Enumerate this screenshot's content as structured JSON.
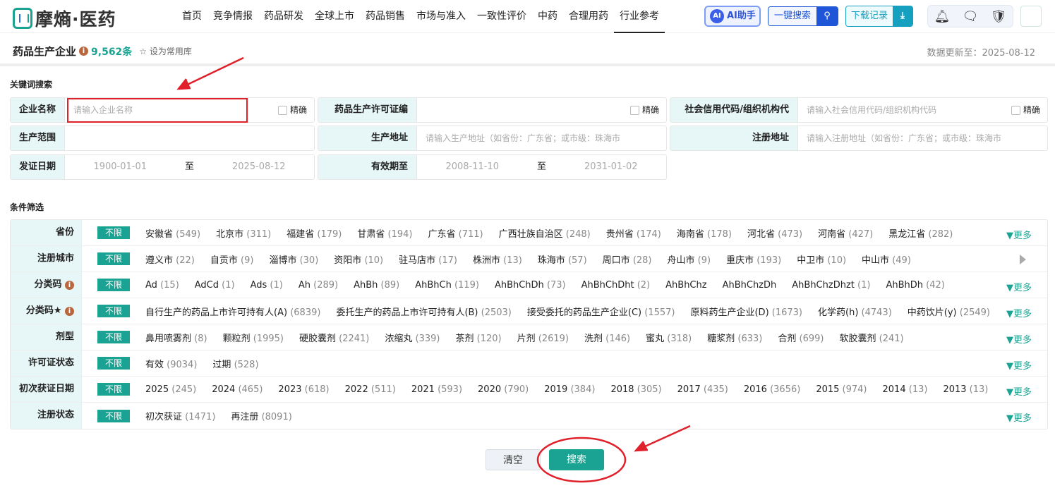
{
  "brand": "摩熵·医药",
  "nav": [
    "首页",
    "竞争情报",
    "药品研发",
    "全球上市",
    "药品销售",
    "市场与准入",
    "一致性评价",
    "中药",
    "合理用药",
    "行业参考"
  ],
  "header_buttons": {
    "ai": "AI助手",
    "one_search": "一键搜索",
    "downloads": "下载记录"
  },
  "page": {
    "title": "药品生产企业",
    "count": "9,562条",
    "favorite": "设为常用库",
    "updated": "数据更新至：2025-08-12"
  },
  "keyword_section": "关键词搜索",
  "fields": {
    "company": {
      "label": "企业名称",
      "placeholder": "请输入企业名称",
      "exact": "精确"
    },
    "license": {
      "label": "药品生产许可证编号",
      "exact": "精确"
    },
    "credit": {
      "label": "社会信用代码/组织机构代码",
      "placeholder": "请输入社会信用代码/组织机构代码",
      "exact": "精确"
    },
    "scope": {
      "label": "生产范围"
    },
    "prod_addr": {
      "label": "生产地址",
      "placeholder": "请输入生产地址（如省份：广东省；或市级：珠海市"
    },
    "reg_addr": {
      "label": "注册地址",
      "placeholder": "请输入注册地址（如省份：广东省；或市级：珠海市"
    },
    "issue_date": {
      "label": "发证日期",
      "from": "1900-01-01",
      "to_label": "至",
      "to": "2025-08-12"
    },
    "valid_until": {
      "label": "有效期至",
      "from": "2008-11-10",
      "to_label": "至",
      "to": "2031-01-02"
    }
  },
  "filter_section": "条件筛选",
  "all_label": "不限",
  "more_label": "更多",
  "filters": [
    {
      "label": "省份",
      "more": true,
      "options": [
        [
          "安徽省",
          "(549)"
        ],
        [
          "北京市",
          "(311)"
        ],
        [
          "福建省",
          "(179)"
        ],
        [
          "甘肃省",
          "(194)"
        ],
        [
          "广东省",
          "(711)"
        ],
        [
          "广西壮族自治区",
          "(248)"
        ],
        [
          "贵州省",
          "(174)"
        ],
        [
          "海南省",
          "(178)"
        ],
        [
          "河北省",
          "(473)"
        ],
        [
          "河南省",
          "(427)"
        ],
        [
          "黑龙江省",
          "(282)"
        ]
      ]
    },
    {
      "label": "注册城市",
      "more": false,
      "options": [
        [
          "遵义市",
          "(22)"
        ],
        [
          "自贡市",
          "(9)"
        ],
        [
          "淄博市",
          "(30)"
        ],
        [
          "资阳市",
          "(10)"
        ],
        [
          "驻马店市",
          "(17)"
        ],
        [
          "株洲市",
          "(13)"
        ],
        [
          "珠海市",
          "(57)"
        ],
        [
          "周口市",
          "(28)"
        ],
        [
          "舟山市",
          "(9)"
        ],
        [
          "重庆市",
          "(193)"
        ],
        [
          "中卫市",
          "(10)"
        ],
        [
          "中山市",
          "(49)"
        ]
      ]
    },
    {
      "label": "分类码",
      "info": true,
      "more": true,
      "options": [
        [
          "Ad",
          "(15)"
        ],
        [
          "AdCd",
          "(1)"
        ],
        [
          "Ads",
          "(1)"
        ],
        [
          "Ah",
          "(289)"
        ],
        [
          "AhBh",
          "(89)"
        ],
        [
          "AhBhCh",
          "(119)"
        ],
        [
          "AhBhChDh",
          "(73)"
        ],
        [
          "AhBhChDht",
          "(2)"
        ],
        [
          "AhBhChz",
          ""
        ],
        [
          "AhBhChzDh",
          ""
        ],
        [
          "AhBhChzDhzt",
          "(1)"
        ],
        [
          "AhBhDh",
          "(42)"
        ]
      ]
    },
    {
      "label": "分类码★",
      "info": true,
      "more": true,
      "options": [
        [
          "自行生产的药品上市许可持有人(A)",
          "(6839)"
        ],
        [
          "委托生产的药品上市许可持有人(B)",
          "(2503)"
        ],
        [
          "接受委托的药品生产企业(C)",
          "(1557)"
        ],
        [
          "原料药生产企业(D)",
          "(1673)"
        ],
        [
          "化学药(h)",
          "(4743)"
        ],
        [
          "中药饮片(y)",
          "(2549)"
        ]
      ]
    },
    {
      "label": "剂型",
      "more": true,
      "options": [
        [
          "鼻用喷雾剂",
          "(8)"
        ],
        [
          "颗粒剂",
          "(1995)"
        ],
        [
          "硬胶囊剂",
          "(2241)"
        ],
        [
          "浓缩丸",
          "(339)"
        ],
        [
          "茶剂",
          "(120)"
        ],
        [
          "片剂",
          "(2619)"
        ],
        [
          "洗剂",
          "(146)"
        ],
        [
          "蜜丸",
          "(318)"
        ],
        [
          "糖浆剂",
          "(633)"
        ],
        [
          "合剂",
          "(699)"
        ],
        [
          "软胶囊剂",
          "(241)"
        ]
      ]
    },
    {
      "label": "许可证状态",
      "more": true,
      "options": [
        [
          "有效",
          "(9034)"
        ],
        [
          "过期",
          "(528)"
        ]
      ]
    },
    {
      "label": "初次获证日期",
      "more": true,
      "options": [
        [
          "2025",
          "(245)"
        ],
        [
          "2024",
          "(465)"
        ],
        [
          "2023",
          "(618)"
        ],
        [
          "2022",
          "(511)"
        ],
        [
          "2021",
          "(593)"
        ],
        [
          "2020",
          "(790)"
        ],
        [
          "2019",
          "(384)"
        ],
        [
          "2018",
          "(305)"
        ],
        [
          "2017",
          "(435)"
        ],
        [
          "2016",
          "(3656)"
        ],
        [
          "2015",
          "(974)"
        ],
        [
          "2014",
          "(13)"
        ],
        [
          "2013",
          "(13)"
        ]
      ]
    },
    {
      "label": "注册状态",
      "more": true,
      "options": [
        [
          "初次获证",
          "(1471)"
        ],
        [
          "再注册",
          "(8091)"
        ]
      ]
    }
  ],
  "actions": {
    "clear": "清空",
    "search": "搜索"
  },
  "colors": {
    "accent": "#1aa392",
    "annotation": "#e0202a"
  }
}
